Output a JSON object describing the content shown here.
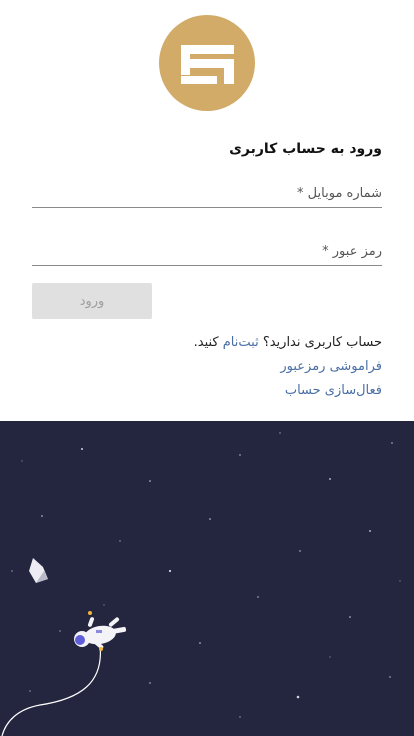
{
  "login": {
    "title": "ورود به حساب کاربری",
    "mobile_placeholder": "شماره موبایل *",
    "password_placeholder": "رمز عبور *",
    "submit_label": "ورود"
  },
  "links": {
    "no_account_prefix": "حساب کاربری ندارید؟",
    "register_label": "ثبت‌نام",
    "no_account_suffix": "کنید.",
    "forgot_password": "فراموشی رمزعبور",
    "activate_account": "فعال‌سازی حساب"
  },
  "colors": {
    "brand_gold": "#d1ab67",
    "link_blue": "#4a6fa5",
    "space_bg": "#24253f"
  },
  "icons": {
    "logo": "brand-logo-icon",
    "illustration": "astronaut-in-space"
  }
}
